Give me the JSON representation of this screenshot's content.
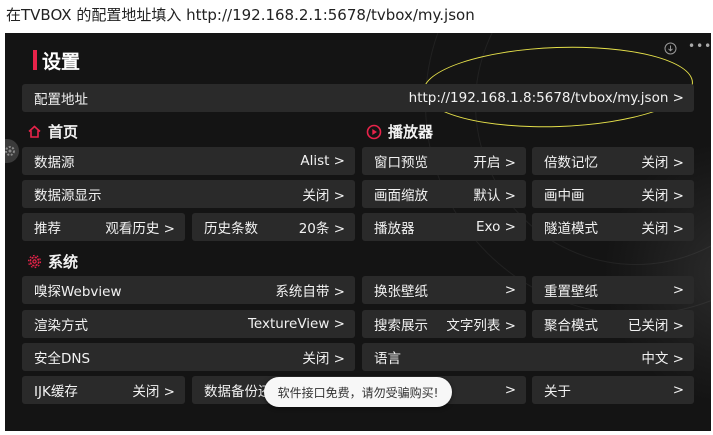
{
  "caption": "在TVBOX 的配置地址填入 http://192.168.2.1:5678/tvbox/my.json",
  "colors": {
    "accent": "#e8234a",
    "highlight": "#e5e04a",
    "cell_bg": "#2a2a2a",
    "screen_bg": "#141414"
  },
  "header": {
    "title": "设置",
    "icons": [
      "download-icon",
      "more-icon"
    ]
  },
  "config": {
    "label": "配置地址",
    "value": "http://192.168.1.8:5678/tvbox/my.json >"
  },
  "sections": {
    "home": "首页",
    "player": "播放器",
    "system": "系统"
  },
  "rows": {
    "datasource": {
      "label": "数据源",
      "value": "Alist >"
    },
    "datasource_display": {
      "label": "数据源显示",
      "value": "关闭 >"
    },
    "recommend": {
      "label": "推荐",
      "value": "观看历史 >"
    },
    "history_count": {
      "label": "历史条数",
      "value": "20条 >"
    },
    "window_preview": {
      "label": "窗口预览",
      "value": "开启 >"
    },
    "screen_scale": {
      "label": "画面缩放",
      "value": "默认 >"
    },
    "player": {
      "label": "播放器",
      "value": "Exo >"
    },
    "speed_memory": {
      "label": "倍数记忆",
      "value": "关闭 >"
    },
    "pip": {
      "label": "画中画",
      "value": "关闭 >"
    },
    "tunnel": {
      "label": "隧道模式",
      "value": "关闭 >"
    },
    "webview": {
      "label": "嗅探Webview",
      "value": "系统自带 >"
    },
    "render": {
      "label": "渲染方式",
      "value": "TextureView >"
    },
    "dns": {
      "label": "安全DNS",
      "value": "关闭 >"
    },
    "ijk": {
      "label": "IJK缓存",
      "value": "关闭 >"
    },
    "backup": {
      "label": "数据备份还",
      "value": "",
      "arrow": ">"
    },
    "wallpaper_switch": {
      "label": "换张壁纸",
      "value": ">"
    },
    "search_display": {
      "label": "搜索展示",
      "value": "文字列表 >"
    },
    "language": {
      "label": "语言",
      "value": "中文 >"
    },
    "wallpaper_reset": {
      "label": "重置壁纸",
      "value": ">"
    },
    "aggregate": {
      "label": "聚合模式",
      "value": "已关闭 >"
    },
    "about": {
      "label": "关于",
      "value": ">"
    }
  },
  "toast": "软件接口免费，请勿受骗购买!"
}
